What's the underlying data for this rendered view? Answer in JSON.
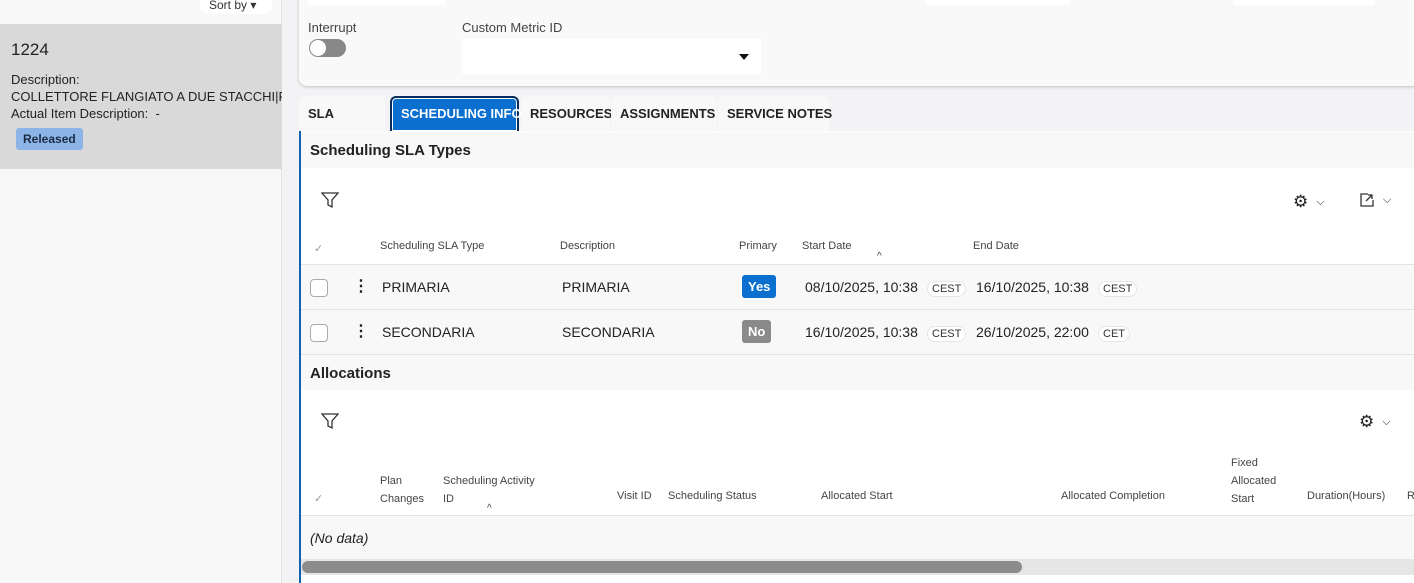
{
  "left": {
    "sort_label": "Sort by",
    "card": {
      "number": "1224",
      "description_label": "Description:",
      "description_value": "COLLETTORE FLANGIATO A DUE STACCHI|PEAD",
      "actual_item_label": "Actual Item Description:",
      "actual_item_value": "-",
      "status": "Released"
    }
  },
  "form": {
    "interrupt_label": "Interrupt",
    "interrupt_on": false,
    "custom_metric_label": "Custom Metric ID",
    "custom_metric_value": ""
  },
  "tabs": [
    {
      "label": "SLA"
    },
    {
      "label": "SCHEDULING INFO",
      "active": true
    },
    {
      "label": "RESOURCES"
    },
    {
      "label": "ASSIGNMENTS"
    },
    {
      "label": "SERVICE NOTES"
    }
  ],
  "sla_types": {
    "title": "Scheduling SLA Types",
    "columns": [
      "Scheduling SLA Type",
      "Description",
      "Primary",
      "Start Date",
      "End Date"
    ],
    "rows": [
      {
        "type": "PRIMARIA",
        "description": "PRIMARIA",
        "primary": "Yes",
        "start": "08/10/2025, 10:38",
        "start_tz": "CEST",
        "end": "16/10/2025, 10:38",
        "end_tz": "CEST"
      },
      {
        "type": "SECONDARIA",
        "description": "SECONDARIA",
        "primary": "No",
        "start": "16/10/2025, 10:38",
        "start_tz": "CEST",
        "end": "26/10/2025, 22:00",
        "end_tz": "CET"
      }
    ]
  },
  "allocations": {
    "title": "Allocations",
    "columns": {
      "plan_changes": [
        "Plan",
        "Changes"
      ],
      "activity_id": [
        "Scheduling Activity",
        "ID"
      ],
      "visit_id": "Visit ID",
      "status": "Scheduling Status",
      "alloc_start": "Allocated Start",
      "alloc_completion": "Allocated Completion",
      "fixed_start": [
        "Fixed",
        "Allocated",
        "Start"
      ],
      "duration": "Duration(Hours)",
      "next": "R"
    },
    "empty_text": "(No data)"
  },
  "colors": {
    "accent": "#0b6fd0",
    "yes": "#0b6fd0",
    "no": "#8a8a8a",
    "released": "#8db4e6"
  }
}
